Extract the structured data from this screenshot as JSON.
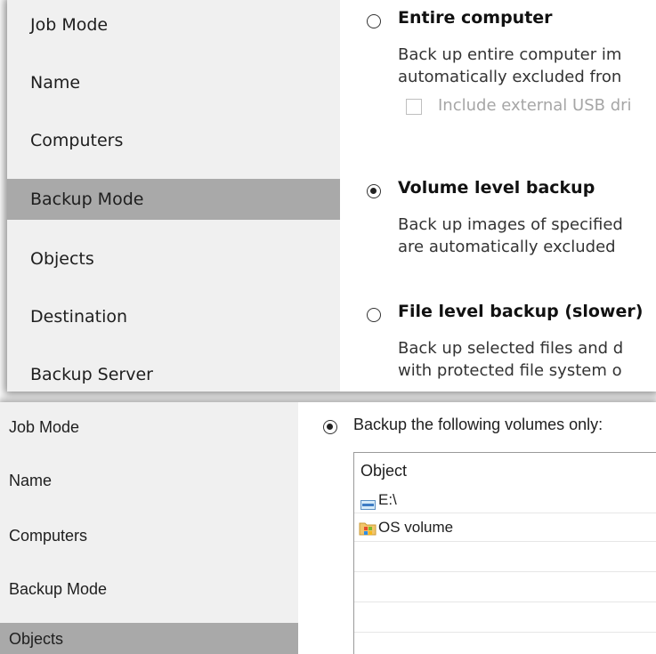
{
  "top_panel": {
    "nav_items": [
      {
        "label": "Job Mode"
      },
      {
        "label": "Name"
      },
      {
        "label": "Computers"
      },
      {
        "label": "Backup Mode",
        "selected": true
      },
      {
        "label": "Objects"
      },
      {
        "label": "Destination"
      },
      {
        "label": "Backup Server"
      }
    ],
    "options": {
      "entire_computer": {
        "title": "Entire computer",
        "desc_line1": "Back up entire computer im",
        "desc_line2": "automatically excluded fron",
        "checkbox_label": "Include external USB dri",
        "selected": false
      },
      "volume_level": {
        "title": "Volume level backup",
        "desc_line1": "Back up images of specified",
        "desc_line2": "are automatically excluded",
        "selected": true
      },
      "file_level": {
        "title": "File level backup (slower)",
        "desc_line1": "Back up selected files and d",
        "desc_line2": "with protected file system o",
        "selected": false
      }
    }
  },
  "bottom_panel": {
    "nav_items": [
      {
        "label": "Job Mode"
      },
      {
        "label": "Name"
      },
      {
        "label": "Computers"
      },
      {
        "label": "Backup Mode"
      },
      {
        "label": "Objects",
        "selected": true
      }
    ],
    "volumes_option_label": "Backup the following volumes only:",
    "table": {
      "header": "Object",
      "rows": [
        {
          "label": "E:\\",
          "icon": "drive-icon"
        },
        {
          "label": "OS volume",
          "icon": "os-volume-icon"
        }
      ]
    }
  },
  "colors": {
    "sidebar_bg": "#f0f0f0",
    "selected_nav_bg": "#a9a9a9"
  }
}
